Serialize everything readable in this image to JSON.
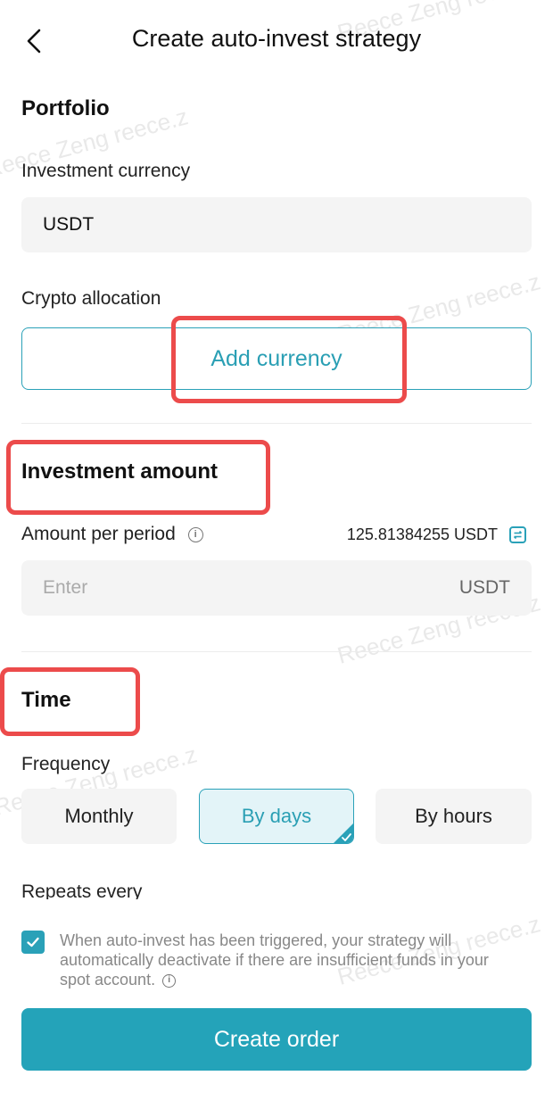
{
  "header": {
    "title": "Create auto-invest strategy",
    "back_icon": "chevron-left-icon"
  },
  "portfolio": {
    "section_title": "Portfolio",
    "currency_label": "Investment currency",
    "currency_value": "USDT",
    "allocation_label": "Crypto allocation",
    "add_currency_label": "Add currency"
  },
  "investment": {
    "section_title": "Investment amount",
    "amount_label": "Amount per period",
    "available_balance": "125.81384255 USDT",
    "amount_placeholder": "Enter",
    "amount_unit": "USDT"
  },
  "time": {
    "section_title": "Time",
    "frequency_label": "Frequency",
    "options": [
      "Monthly",
      "By days",
      "By hours"
    ],
    "selected": "By days",
    "repeats_label": "Repeats every"
  },
  "notice": {
    "checked": true,
    "text": "When auto-invest has been triggered, your strategy will automatically deactivate if there are insufficient funds in your spot account."
  },
  "footer": {
    "create_label": "Create order"
  },
  "watermarks": [
    "Reece Zeng reece.z",
    "Reece Zeng reece.z",
    "Reece Zeng reece.z",
    "Reece Zeng reece.z",
    "Reece Zeng reece.z",
    "Reece Zeng reece.z"
  ],
  "colors": {
    "accent": "#24a3b9",
    "highlight": "#ec4b4b",
    "field_bg": "#f4f4f4"
  }
}
